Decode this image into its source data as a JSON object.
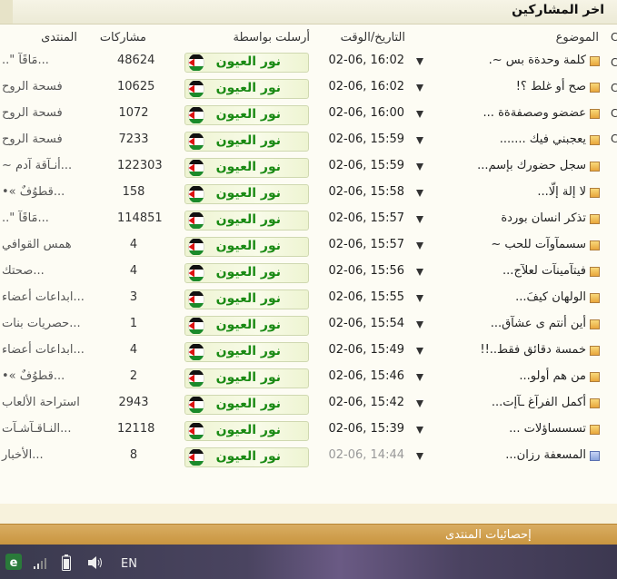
{
  "header": {
    "title": "اخر المشاركين"
  },
  "columns": {
    "subject": "الموضوع",
    "date": "التاريخ/الوقت",
    "sender": "أرسلت بواسطة",
    "posts": "مشاركات",
    "forum": "المنتدى"
  },
  "rows": [
    {
      "subject": "كلمة وحدةة بس ~.",
      "date": "02-06, 16:02",
      "sender": "نور العيون",
      "posts": "48624",
      "forum": "..\" مَاقَآ..."
    },
    {
      "subject": "صح أو غلط ؟!",
      "date": "02-06, 16:02",
      "sender": "نور العيون",
      "posts": "10625",
      "forum": "فسحة الروح"
    },
    {
      "subject": "عضضو وصصفةةة ...",
      "date": "02-06, 16:00",
      "sender": "نور العيون",
      "posts": "1072",
      "forum": "فسحة الروح"
    },
    {
      "subject": "يعجبني فيك .......",
      "date": "02-06, 15:59",
      "sender": "نور العيون",
      "posts": "7233",
      "forum": "فسحة الروح"
    },
    {
      "subject": "سجل حضورك بإسم...",
      "date": "02-06, 15:59",
      "sender": "نور العيون",
      "posts": "122303",
      "forum": "~ أنـآقة آدم..."
    },
    {
      "subject": "لا إلة إلّا...",
      "date": "02-06, 15:58",
      "sender": "نور العيون",
      "posts": "158",
      "forum": "•« قطوُفٌ..."
    },
    {
      "subject": "تذكر انسان بوردة",
      "date": "02-06, 15:57",
      "sender": "نور العيون",
      "posts": "114851",
      "forum": "..\" مَاقَآ..."
    },
    {
      "subject": "سسمآوآت للحب ~",
      "date": "02-06, 15:57",
      "sender": "نور العيون",
      "posts": "4",
      "forum": "همس القوافي"
    },
    {
      "subject": "فيتآمينآت لعلآج...",
      "date": "02-06, 15:56",
      "sender": "نور العيون",
      "posts": "4",
      "forum": "صحتك..."
    },
    {
      "subject": "الولهان كيفَ...",
      "date": "02-06, 15:55",
      "sender": "نور العيون",
      "posts": "3",
      "forum": "ابداعات أعضاء..."
    },
    {
      "subject": "أين أنتم ى عشآق...",
      "date": "02-06, 15:54",
      "sender": "نور العيون",
      "posts": "1",
      "forum": "حصريات بنات..."
    },
    {
      "subject": "خمسة دقائق فقط..!!",
      "date": "02-06, 15:49",
      "sender": "نور العيون",
      "posts": "4",
      "forum": "ابداعات أعضاء..."
    },
    {
      "subject": "من هم أولو...",
      "date": "02-06, 15:46",
      "sender": "نور العيون",
      "posts": "2",
      "forum": "•« قطوُفٌ..."
    },
    {
      "subject": "أكمل الفرآغ ـآإت...",
      "date": "02-06, 15:42",
      "sender": "نور العيون",
      "posts": "2943",
      "forum": "استراحة الألعاب"
    },
    {
      "subject": "تسسساؤلات ...",
      "date": "02-06, 15:39",
      "sender": "نور العيون",
      "posts": "12118",
      "forum": "النـاقـآشـآت..."
    },
    {
      "subject": "المسعفة رزان...",
      "date": "02-06, 14:44",
      "sender": "نور العيون",
      "posts": "8",
      "forum": "الأخبار..."
    }
  ],
  "stats": {
    "title": "إحصائيات المنتدى"
  },
  "taskbar": {
    "language": "EN"
  },
  "colors": {
    "accent": "#c8943e",
    "badge_text": "#1a8a14"
  }
}
